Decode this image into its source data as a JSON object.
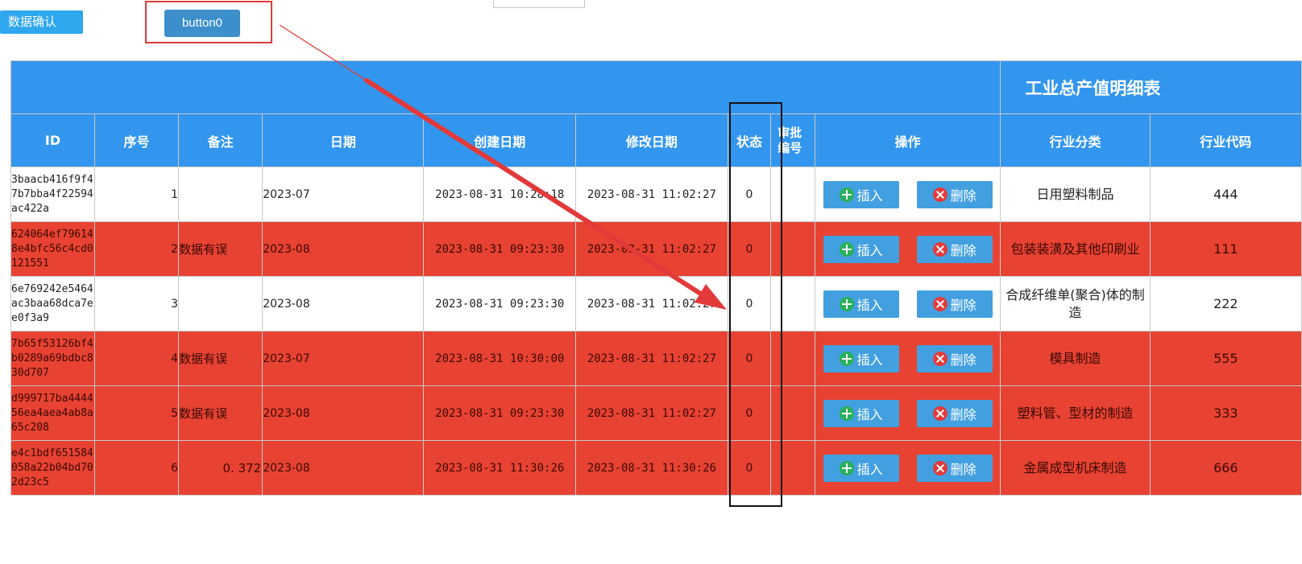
{
  "toolbar": {
    "confirm_label": "数据确认",
    "button0_label": "button0"
  },
  "report_title": "工业总产值明细表",
  "columns": {
    "id": "ID",
    "seq": "序号",
    "note": "备注",
    "date": "日期",
    "created": "创建日期",
    "modified": "修改日期",
    "status": "状态",
    "approve_line1": "审批",
    "approve_line2": "编号",
    "ops": "操作",
    "industry": "行业分类",
    "code": "行业代码"
  },
  "actions": {
    "insert": "插入",
    "delete": "删除"
  },
  "rows": [
    {
      "id": "3baacb416f9f47b7bba4f22594ac422a",
      "seq": "1",
      "note": "",
      "date": "2023-07",
      "created": "2023-08-31 10:28:18",
      "modified": "2023-08-31 11:02:27",
      "status": "0",
      "approve": "",
      "industry": "日用塑料制品",
      "code": "444",
      "highlight": false
    },
    {
      "id": "624064ef796148e4bfc56c4cd0121551",
      "seq": "2",
      "note": "数据有误",
      "date": "2023-08",
      "created": "2023-08-31 09:23:30",
      "modified": "2023-08-31 11:02:27",
      "status": "0",
      "approve": "",
      "industry": "包装装潢及其他印刷业",
      "code": "111",
      "highlight": true
    },
    {
      "id": "6e769242e5464ac3baa68dca7ee0f3a9",
      "seq": "3",
      "note": "",
      "date": "2023-08",
      "created": "2023-08-31 09:23:30",
      "modified": "2023-08-31 11:02:27",
      "status": "0",
      "approve": "",
      "industry": "合成纤维单(聚合)体的制造",
      "code": "222",
      "highlight": false
    },
    {
      "id": "7b65f53126bf4b0289a69bdbc830d707",
      "seq": "4",
      "note": "数据有误",
      "date": "2023-07",
      "created": "2023-08-31 10:30:00",
      "modified": "2023-08-31 11:02:27",
      "status": "0",
      "approve": "",
      "industry": "模具制造",
      "code": "555",
      "highlight": true
    },
    {
      "id": "d999717ba444456ea4aea4ab8a65c208",
      "seq": "5",
      "note": "数据有误",
      "date": "2023-08",
      "created": "2023-08-31 09:23:30",
      "modified": "2023-08-31 11:02:27",
      "status": "0",
      "approve": "",
      "industry": "塑料管、型材的制造",
      "code": "333",
      "highlight": true
    },
    {
      "id": "e4c1bdf651584058a22b04bd702d23c5",
      "seq": "6",
      "note": "0. 372",
      "date": "2023-08",
      "created": "2023-08-31 11:30:26",
      "modified": "2023-08-31 11:30:26",
      "status": "0",
      "approve": "",
      "industry": "金属成型机床制造",
      "code": "666",
      "highlight": true
    }
  ],
  "colors": {
    "header_blue": "#3396ee",
    "highlight_red": "#e84232",
    "annotation_red": "#e23a3a",
    "action_button": "#42a0e0"
  }
}
